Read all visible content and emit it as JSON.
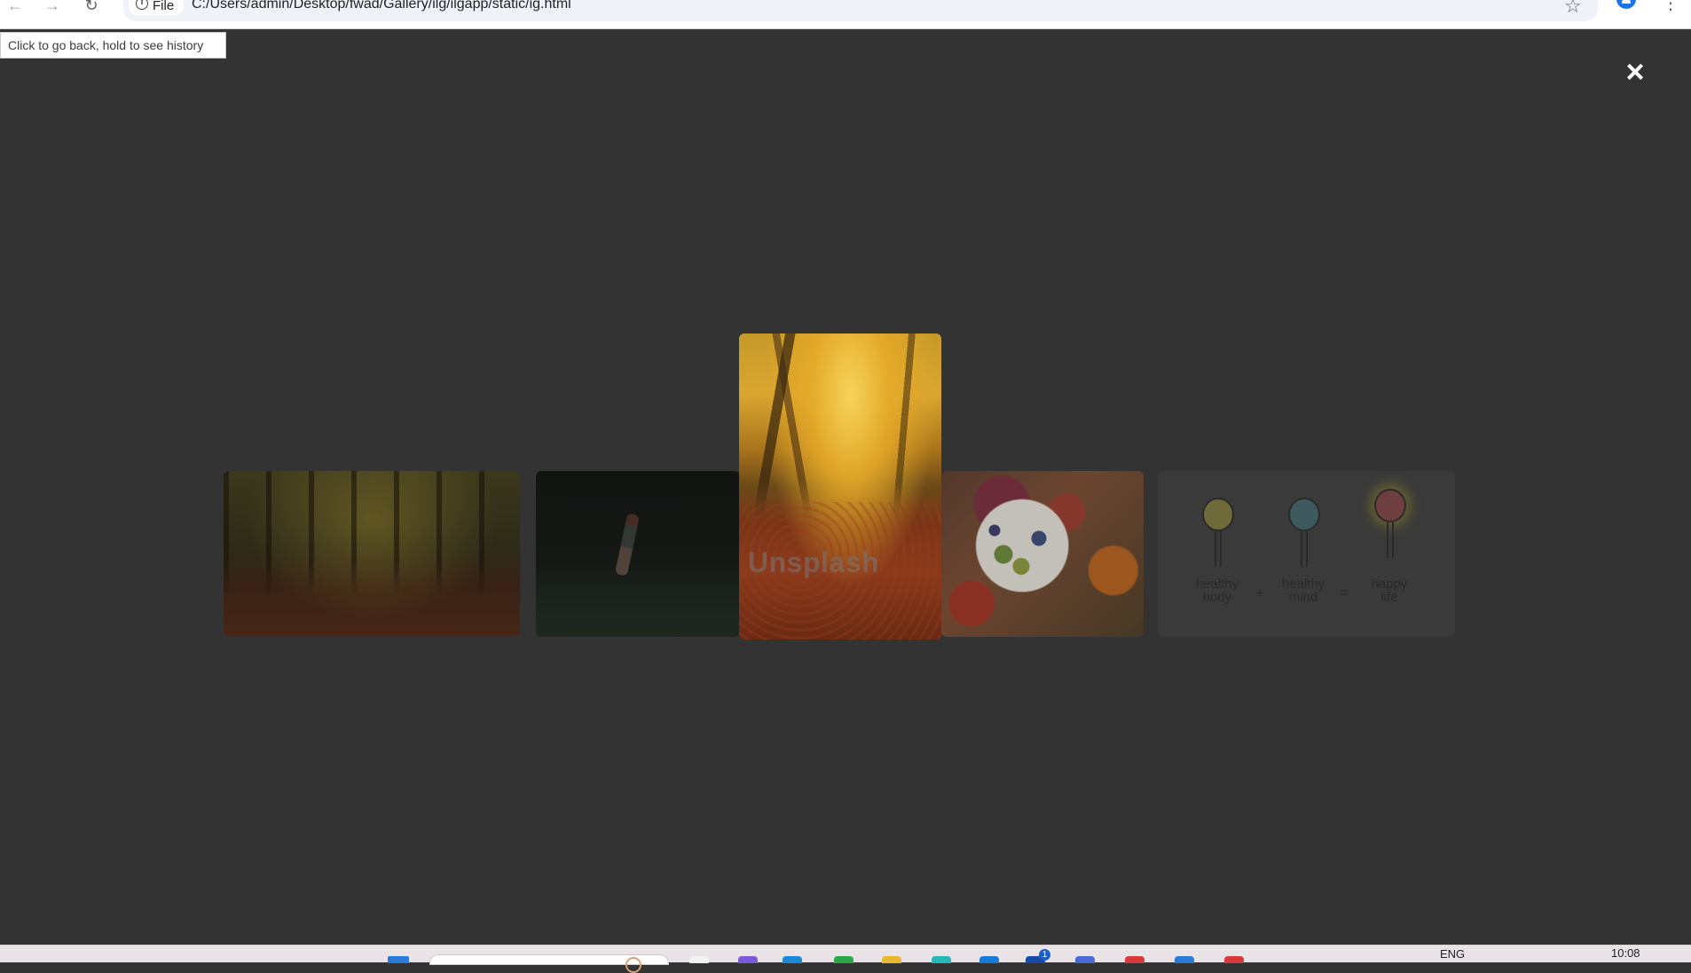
{
  "browser": {
    "scheme_chip": "File",
    "url": "C:/Users/admin/Desktop/fwad/Gallery/ilg/ilgapp/static/ig.html",
    "back_tooltip": "Click to go back, hold to see history"
  },
  "lightbox": {
    "close_icon": "×",
    "images": [
      {
        "name": "autumn-forest-path-dim"
      },
      {
        "name": "runner-in-dark-field"
      },
      {
        "name": "autumn-forest-path",
        "watermark": "Unsplash",
        "active": true
      },
      {
        "name": "fruit-bowl"
      },
      {
        "name": "healthy-body-mind-life-illustration",
        "labels": [
          "healthy\nbody",
          "healthy\nmind",
          "happy\nlife"
        ],
        "operators": [
          "+",
          "="
        ]
      }
    ]
  },
  "taskbar": {
    "language": "ENG",
    "time": "10:08",
    "badge_count": "1"
  },
  "colors": {
    "overlay_bg": "#333333",
    "accent": "#1a73e8"
  }
}
